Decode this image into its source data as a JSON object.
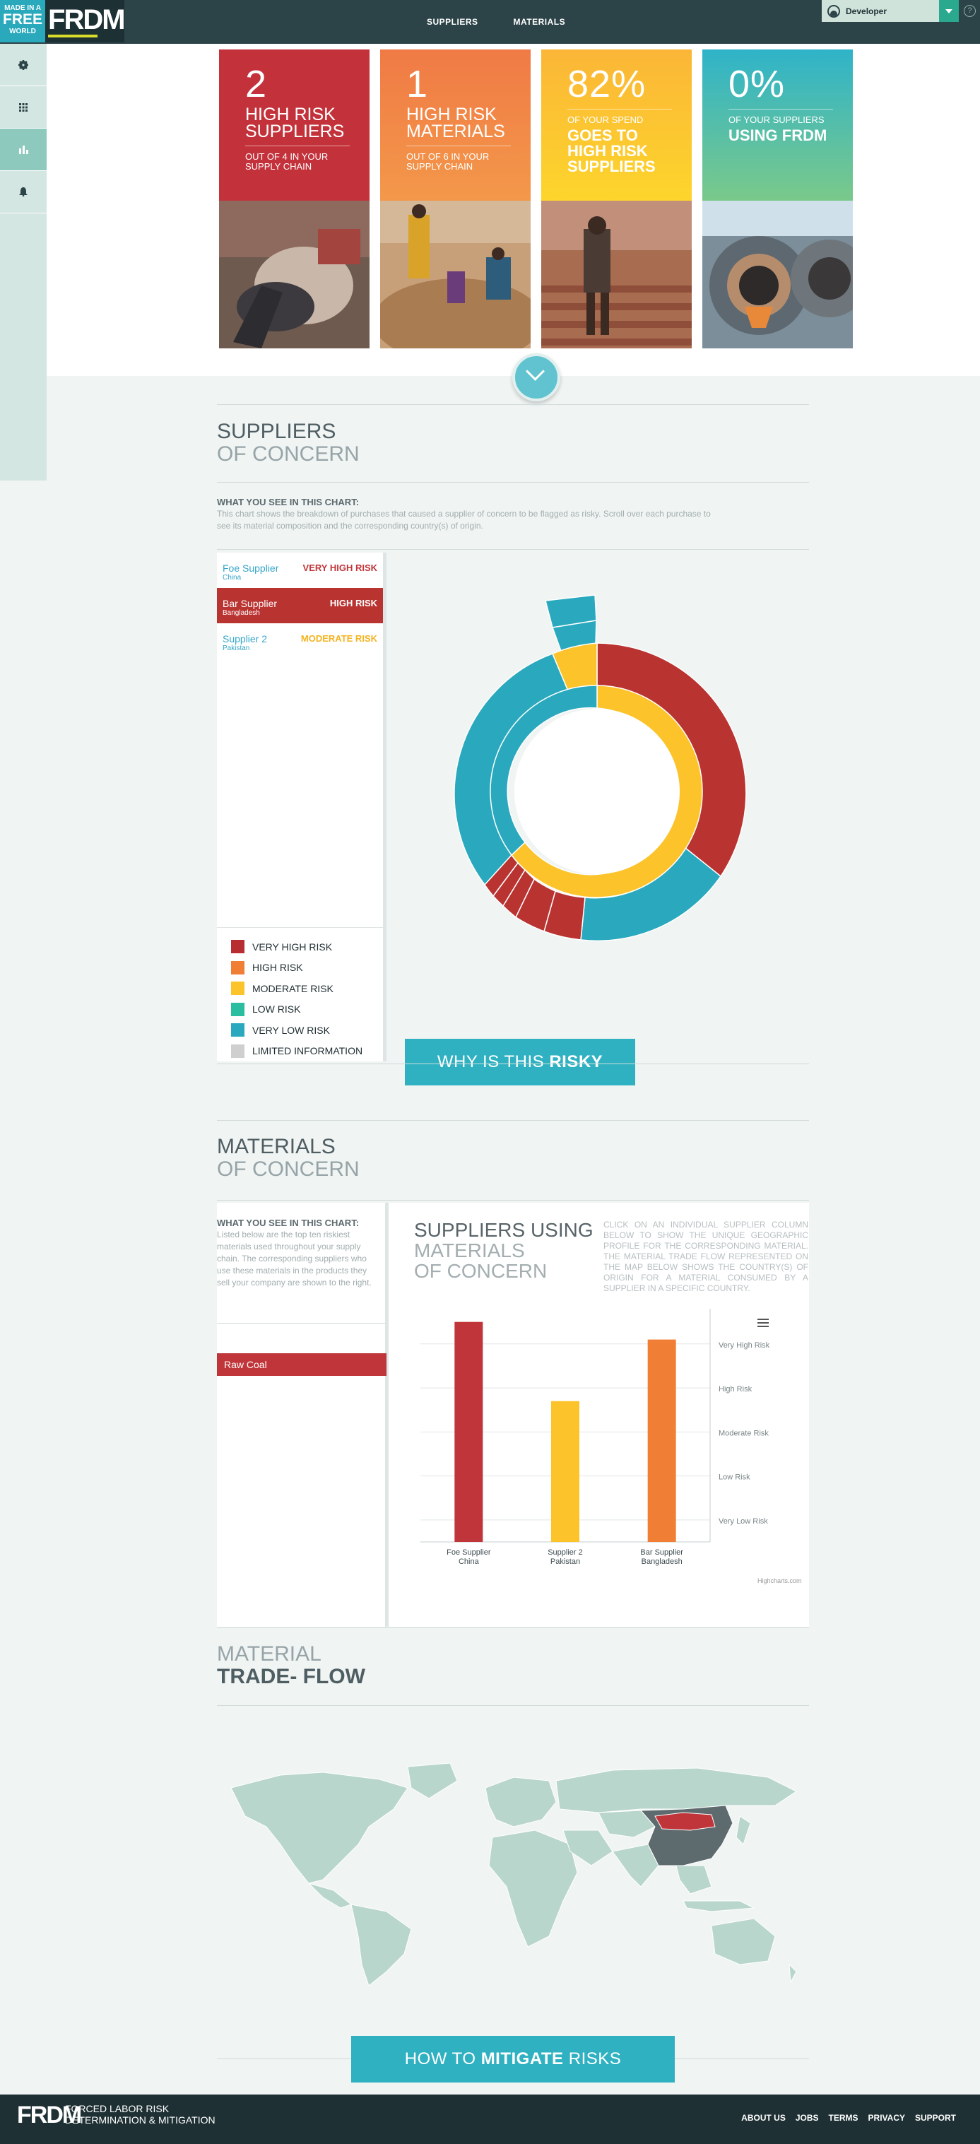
{
  "brand": {
    "badge_line1": "MADE IN A",
    "badge_line2": "FREE",
    "badge_line3": "WORLD",
    "logo": "FRDM"
  },
  "nav": {
    "items": [
      "SUPPLIERS",
      "MATERIALS"
    ]
  },
  "user": {
    "name": "Developer",
    "help": "?"
  },
  "sidebar": {
    "icons": [
      "gear-icon",
      "grid-icon",
      "bar-chart-icon",
      "bell-icon"
    ]
  },
  "cards": [
    {
      "big": "2",
      "head": "HIGH RISK SUPPLIERS",
      "sub": "OUT OF 4 IN YOUR SUPPLY CHAIN",
      "color": "#c3323b"
    },
    {
      "big": "1",
      "head": "HIGH RISK MATERIALS",
      "sub": "OUT OF 6 IN YOUR SUPPLY CHAIN",
      "color": "#f0803c"
    },
    {
      "big": "82%",
      "sub_top": "OF YOUR SPEND",
      "head": "GOES TO HIGH RISK SUPPLIERS",
      "color": "#fcc32b"
    },
    {
      "big": "0%",
      "sub_top": "OF YOUR SUPPLIERS",
      "head": "USING FRDM",
      "color": "#36b7bf"
    }
  ],
  "suppliers": {
    "title": "SUPPLIERS",
    "title_light": "OF CONCERN",
    "what_title": "WHAT YOU SEE IN THIS CHART:",
    "what_text": "This chart shows the breakdown of purchases that caused a supplier of concern to be flagged as risky. Scroll over each purchase to see its material composition and the corresponding country(s) of origin.",
    "list": [
      {
        "name": "Foe Supplier",
        "country": "China",
        "risk": "VERY HIGH RISK",
        "risk_color": "#c0353a"
      },
      {
        "name": "Bar Supplier",
        "country": "Bangladesh",
        "risk": "HIGH RISK",
        "risk_color": "#ffffff"
      },
      {
        "name": "Supplier 2",
        "country": "Pakistan",
        "risk": "MODERATE RISK",
        "risk_color": "#f5b321"
      }
    ],
    "legend": [
      {
        "label": "VERY HIGH RISK",
        "color": "#b72d32"
      },
      {
        "label": "HIGH RISK",
        "color": "#f07e35"
      },
      {
        "label": "MODERATE RISK",
        "color": "#fcc32b"
      },
      {
        "label": "LOW RISK",
        "color": "#2bbd9f"
      },
      {
        "label": "VERY LOW RISK",
        "color": "#2aa9be"
      },
      {
        "label": "LIMITED INFORMATION",
        "color": "#cfcfcf"
      }
    ],
    "button": {
      "prefix": "WHY IS THIS ",
      "bold": "RISKY"
    }
  },
  "materials": {
    "title": "MATERIALS",
    "title_light": "OF CONCERN",
    "what_title": "WHAT YOU SEE IN THIS CHART:",
    "what_text": "Listed below are the top ten riskiest materials used throughout your supply chain. The corresponding suppliers who use these materials in the products they sell your company are shown to the right.",
    "items": [
      "Raw Coal"
    ],
    "chart_title": "SUPPLIERS USING",
    "chart_title_light1": "MATERIALS",
    "chart_title_light2": "OF CONCERN",
    "chart_desc": "CLICK ON AN INDIVIDUAL SUPPLIER COLUMN BELOW TO SHOW THE UNIQUE GEOGRAPHIC PROFILE FOR THE CORRESPONDING MATERIAL. THE MATERIAL TRADE FLOW REPRESENTED ON THE MAP BELOW SHOWS THE COUNTRY(S) OF ORIGIN FOR A MATERIAL CONSUMED BY A SUPPLIER IN A SPECIFIC COUNTRY.",
    "credit": "Highcharts.com"
  },
  "chart_data": {
    "type": "bar",
    "categories": [
      "Foe Supplier China",
      "Supplier 2 Pakistan",
      "Bar Supplier Bangladesh"
    ],
    "category_lines": [
      [
        "Foe Supplier",
        "China"
      ],
      [
        "Supplier 2",
        "Pakistan"
      ],
      [
        "Bar Supplier",
        "Bangladesh"
      ]
    ],
    "values": [
      5,
      3.2,
      4.6
    ],
    "colors": [
      "#c0353a",
      "#fcc32b",
      "#f07e35"
    ],
    "y_tick_labels": [
      "Very Low Risk",
      "Low Risk",
      "Moderate Risk",
      "High Risk",
      "Very High Risk"
    ],
    "ylim": [
      0,
      5.3
    ],
    "grid": true
  },
  "trade_flow": {
    "title_light": "MATERIAL",
    "title": "TRADE- FLOW",
    "highlight": "China",
    "button": {
      "prefix": "HOW TO ",
      "bold": "MITIGATE",
      "suffix": " RISKS"
    }
  },
  "footer": {
    "logo": "FRDM",
    "tag1": "FORCED LABOR RISK",
    "tag2": "DETERMINATION & MITIGATION",
    "links": [
      "ABOUT US",
      "JOBS",
      "TERMS",
      "PRIVACY",
      "SUPPORT"
    ]
  }
}
